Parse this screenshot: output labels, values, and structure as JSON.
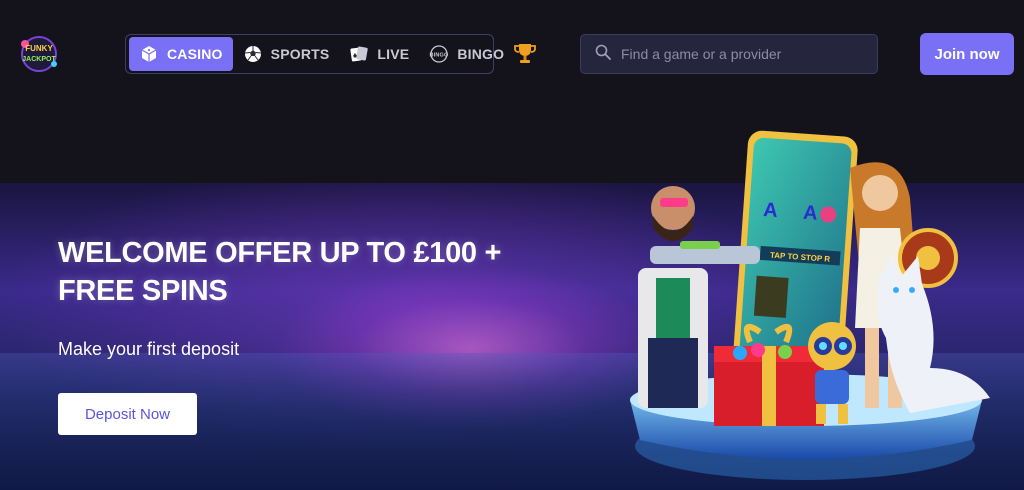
{
  "brand": {
    "logo_text_line1": "FUNKY",
    "logo_text_line2": "JACKPOT"
  },
  "nav": {
    "items": [
      {
        "label": "CASINO",
        "icon": "dice-icon",
        "active": true
      },
      {
        "label": "SPORTS",
        "icon": "soccer-ball-icon",
        "active": false
      },
      {
        "label": "LIVE",
        "icon": "cards-icon",
        "active": false
      },
      {
        "label": "BINGO",
        "icon": "bingo-ball-icon",
        "active": false
      }
    ]
  },
  "search": {
    "placeholder": "Find a game or a provider",
    "icon": "search-icon"
  },
  "header": {
    "join_label": "Join now"
  },
  "hero": {
    "title": "WELCOME OFFER UP TO £100 + FREE SPINS",
    "subtitle": "Make your first deposit",
    "cta_label": "Deposit Now",
    "phone_text": "TAP TO STOP R"
  },
  "colors": {
    "accent": "#7a70f5",
    "background": "#14131c",
    "search_bg": "#25253d"
  }
}
